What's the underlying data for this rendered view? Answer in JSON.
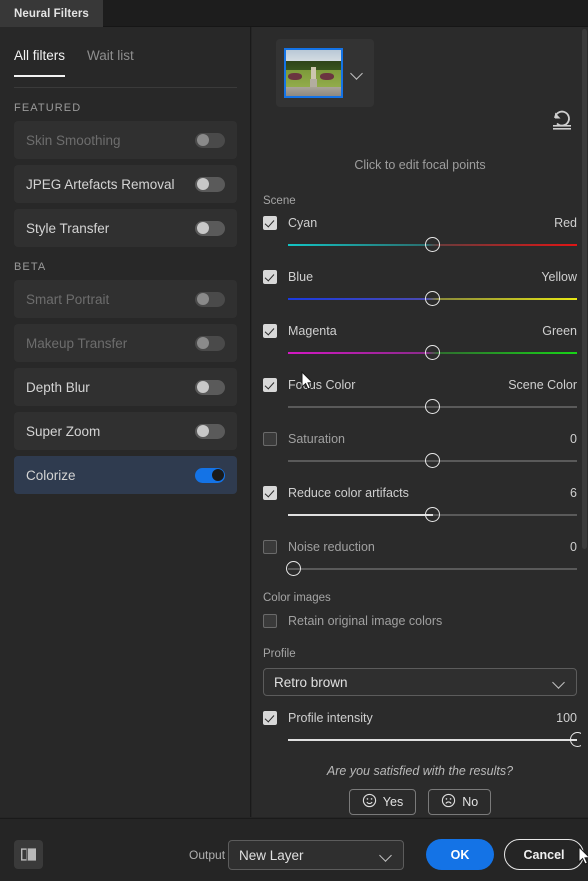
{
  "window": {
    "tab_title": "Neural Filters"
  },
  "sidebar": {
    "tabs": [
      {
        "label": "All filters",
        "active": true
      },
      {
        "label": "Wait list",
        "active": false
      }
    ],
    "groups": [
      {
        "title": "FEATURED",
        "filters": [
          {
            "label": "Skin Smoothing",
            "enabled": false,
            "disabled": true,
            "selected": false
          },
          {
            "label": "JPEG Artefacts Removal",
            "enabled": false,
            "disabled": false,
            "selected": false
          },
          {
            "label": "Style Transfer",
            "enabled": false,
            "disabled": false,
            "selected": false
          }
        ]
      },
      {
        "title": "BETA",
        "filters": [
          {
            "label": "Smart Portrait",
            "enabled": false,
            "disabled": true,
            "selected": false
          },
          {
            "label": "Makeup Transfer",
            "enabled": false,
            "disabled": true,
            "selected": false
          },
          {
            "label": "Depth Blur",
            "enabled": false,
            "disabled": false,
            "selected": false
          },
          {
            "label": "Super Zoom",
            "enabled": false,
            "disabled": false,
            "selected": false
          },
          {
            "label": "Colorize",
            "enabled": true,
            "disabled": false,
            "selected": true
          }
        ]
      }
    ]
  },
  "preview": {
    "thumbnail_alt": "garden-thumbnail",
    "dropdown_icon": "chevron-down-icon",
    "reset_icon": "reset-icon",
    "focal_caption": "Click to edit focal points"
  },
  "scene": {
    "label": "Scene",
    "sliders": [
      {
        "checked": true,
        "left_label": "Cyan",
        "right_label": "Red",
        "value_text": "",
        "knob_pct": 50,
        "gradient": "cyan-red"
      },
      {
        "checked": true,
        "left_label": "Blue",
        "right_label": "Yellow",
        "value_text": "",
        "knob_pct": 50,
        "gradient": "blue-yellow"
      },
      {
        "checked": true,
        "left_label": "Magenta",
        "right_label": "Green",
        "value_text": "",
        "knob_pct": 50,
        "gradient": "magenta-green"
      },
      {
        "checked": true,
        "left_label": "Focus Color",
        "right_label": "Scene Color",
        "value_text": "",
        "knob_pct": 50,
        "gradient": "none"
      },
      {
        "checked": false,
        "left_label": "Saturation",
        "right_label": "",
        "value_text": "0",
        "knob_pct": 50,
        "gradient": "none"
      },
      {
        "checked": true,
        "left_label": "Reduce color artifacts",
        "right_label": "",
        "value_text": "6",
        "knob_pct": 50,
        "gradient": "none",
        "fill_left": true
      },
      {
        "checked": false,
        "left_label": "Noise reduction",
        "right_label": "",
        "value_text": "0",
        "knob_pct": 2,
        "gradient": "none"
      }
    ]
  },
  "color_images": {
    "label": "Color images",
    "retain": {
      "label": "Retain original image colors",
      "checked": false
    }
  },
  "profile": {
    "label": "Profile",
    "value": "Retro brown",
    "dropdown_icon": "chevron-down-icon",
    "intensity": {
      "label": "Profile intensity",
      "checked": true,
      "value_text": "100",
      "knob_pct": 100
    }
  },
  "feedback": {
    "question": "Are you satisfied with the results?",
    "yes_label": "Yes",
    "no_label": "No",
    "yes_icon": "smiley-face-icon",
    "no_icon": "sad-face-icon"
  },
  "footer": {
    "preview_icon": "split-preview-icon",
    "output_label": "Output",
    "output_value": "New Layer",
    "output_dropdown_icon": "chevron-down-icon",
    "ok_label": "OK",
    "cancel_label": "Cancel"
  },
  "colors": {
    "accent_blue": "#1473e6",
    "panel_bg": "#2b2b2b",
    "sidebar_bg": "#282828",
    "selected_row": "#2f3b4f"
  }
}
